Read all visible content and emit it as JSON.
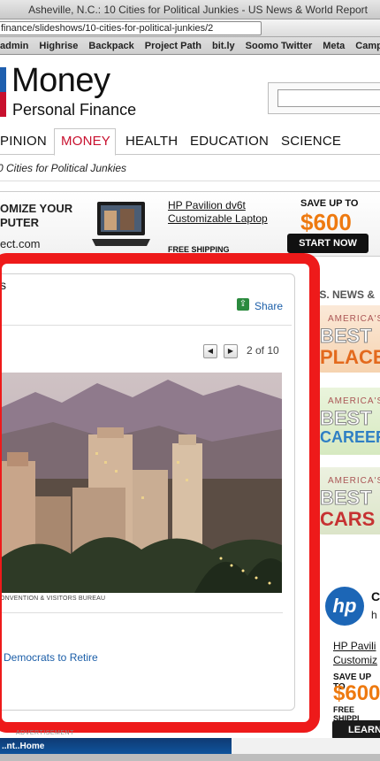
{
  "window": {
    "title": "Asheville, N.C.: 10 Cities for Political Junkies - US News & World Report"
  },
  "browser": {
    "url": "finance/slideshows/10-cities-for-political-junkies/2",
    "bookmarks": [
      "admin",
      "Highrise",
      "Backpack",
      "Project Path",
      "bit.ly",
      "Soomo Twitter",
      "Meta",
      "Campt"
    ]
  },
  "header": {
    "logo_title": "Money",
    "logo_subtitle": "Personal Finance"
  },
  "nav": {
    "items": [
      "PINION",
      "MONEY",
      "HEALTH",
      "EDUCATION",
      "SCIENCE"
    ],
    "active": "MONEY"
  },
  "breadcrumb": "0 Cities for Political Junkies",
  "banner_ad": {
    "left_line1": "OMIZE YOUR",
    "left_line2": "PUTER",
    "left_domain": "ect.com",
    "product_line1": "HP Pavilion dv6t",
    "product_line2": "Customizable Laptop",
    "free_shipping": "FREE SHIPPING",
    "save_label": "SAVE UP TO",
    "save_amount": "$600",
    "cta": "START NOW"
  },
  "slideshow": {
    "title_fragment": "s",
    "share_label": "Share",
    "counter": "2 of 10",
    "photo_credit": "ONVENTION & VISITORS BUREAU",
    "related_link": "Democrats to Retire"
  },
  "advertisement_label": "ADVERTISEMENT",
  "bottom_ad_text": "..nt..Home",
  "sidebar": {
    "heading": ".S. NEWS &",
    "tiles": [
      {
        "small": "AMERICA'S",
        "big": "BEST",
        "word": "PLACES",
        "color": "#e36a1e"
      },
      {
        "small": "AMERICA'S",
        "big": "BEST",
        "word": "CAREERS",
        "color": "#2f7fc4"
      },
      {
        "small": "AMERICA'S",
        "big": "BEST",
        "word": "CARS",
        "color": "#c63232"
      }
    ],
    "hp_ad": {
      "logo": "hp",
      "letter": "C",
      "letter2": "h",
      "product_line1": "HP Pavili",
      "product_line2": "Customiz",
      "save_label": "SAVE UP TO",
      "save_amount": "$600",
      "free_shipping": "FREE SHIPPI",
      "cta": "LEARN"
    }
  },
  "colors": {
    "highlight_frame": "#ee1a1a",
    "link": "#1b5ea8",
    "accent_orange": "#ee7a10",
    "active_nav": "#c8102e"
  }
}
